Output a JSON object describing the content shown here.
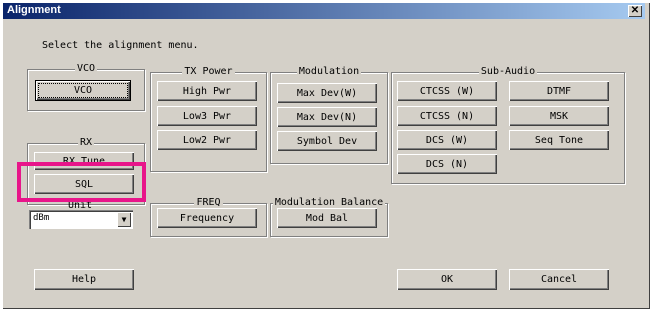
{
  "window": {
    "title": "Alignment",
    "close_glyph": "✕"
  },
  "instruction": "Select the alignment menu.",
  "groups": {
    "vco": {
      "title": "VCO",
      "buttons": [
        "VCO"
      ]
    },
    "tx_power": {
      "title": "TX Power",
      "buttons": [
        "High Pwr",
        "Low3 Pwr",
        "Low2 Pwr"
      ]
    },
    "modulation": {
      "title": "Modulation",
      "buttons": [
        "Max Dev(W)",
        "Max Dev(N)",
        "Symbol Dev"
      ]
    },
    "sub_audio": {
      "title": "Sub-Audio",
      "buttons": [
        "CTCSS (W)",
        "DTMF",
        "CTCSS (N)",
        "MSK",
        "DCS (W)",
        "Seq Tone",
        "DCS (N)"
      ]
    },
    "rx": {
      "title": "RX",
      "buttons": [
        "RX Tune",
        "SQL"
      ]
    },
    "freq": {
      "title": "FREQ",
      "buttons": [
        "Frequency"
      ]
    },
    "mod_balance": {
      "title": "Modulation Balance",
      "buttons": [
        "Mod Bal"
      ]
    }
  },
  "unit_select": {
    "label": "Unit",
    "value": "dBm"
  },
  "footer": {
    "help": "Help",
    "ok": "OK",
    "cancel": "Cancel"
  },
  "colors": {
    "highlight": "#e8158a",
    "titlebar": "#0a246a",
    "face": "#d4d0c8"
  }
}
